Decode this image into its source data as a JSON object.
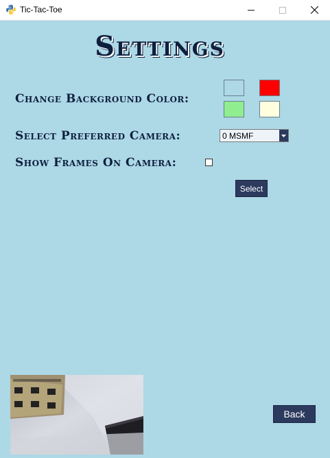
{
  "window": {
    "title": "Tic-Tac-Toe",
    "controls": [
      "minimize",
      "maximize",
      "close"
    ]
  },
  "settings": {
    "heading": "Settings",
    "background_label": "Change Background Color:",
    "background_colors": [
      "#add8e6",
      "#ff0000",
      "#90ee90",
      "#ffffe0"
    ],
    "camera_label": "Select Preferred Camera:",
    "camera_selected": "0 MSMF",
    "frames_label": "Show Frames On Camera:",
    "frames_checked": false,
    "select_button": "Select",
    "back_button": "Back"
  },
  "colors": {
    "client_background": "#add8e6",
    "text": "#0e1f3e",
    "button": "#2c3a5e"
  }
}
